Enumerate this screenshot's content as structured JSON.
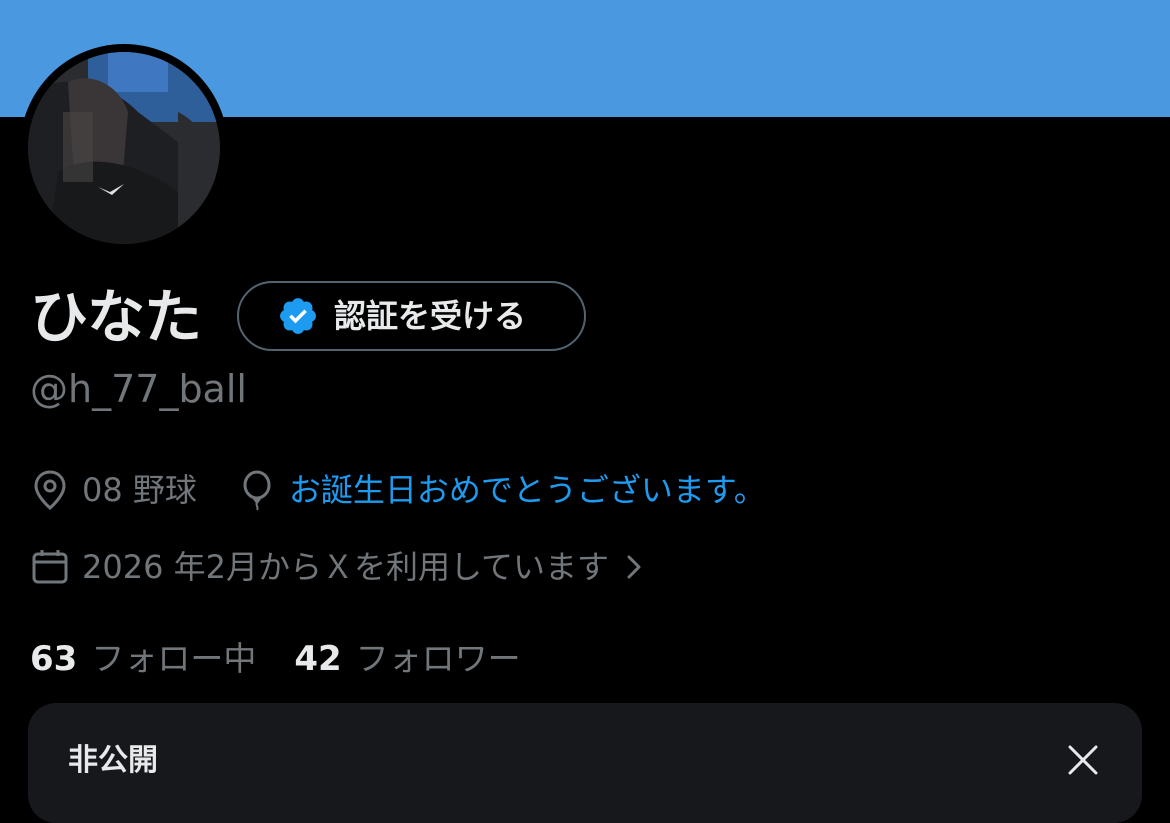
{
  "colors": {
    "banner": "#4a98e0",
    "background": "#000000",
    "primary_text": "#e7e9ea",
    "secondary_text": "#71767b",
    "link": "#1d9bf0",
    "verified_badge": "#1d9bf0",
    "card_background": "#16181c"
  },
  "profile": {
    "display_name": "ひなた",
    "handle": "@h_77_ball",
    "verify_button_label": "認証を受ける",
    "location": "08 野球",
    "birthday_text": "お誕生日おめでとうございます。",
    "joined_text": "2026 年2月からＸを利用しています",
    "following_count": "63",
    "following_label": "フォロー中",
    "followers_count": "42",
    "followers_label": "フォロワー"
  },
  "icons": {
    "verified": "verified-badge-icon",
    "location": "location-pin-icon",
    "birthday": "balloon-icon",
    "joined": "calendar-icon",
    "chevron": "chevron-right-icon",
    "close": "close-icon"
  },
  "private_card": {
    "title": "非公開"
  }
}
